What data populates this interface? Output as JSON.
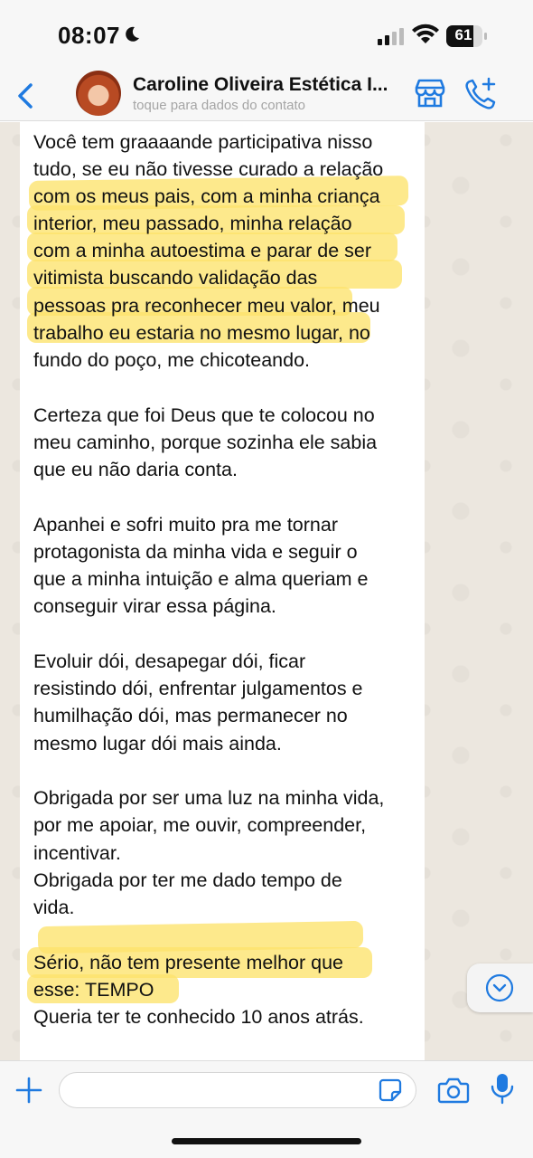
{
  "status_bar": {
    "time": "08:07",
    "battery": "61"
  },
  "header": {
    "contact_name": "Caroline Oliveira Estética I...",
    "contact_subtitle": "toque para dados do contato"
  },
  "message": {
    "lines": [
      "Você tem graaaande participativa nisso",
      "tudo, se eu não tivesse curado a relação",
      "com os meus pais, com a minha criança",
      "interior, meu passado, minha relação",
      "com a minha autoestima e parar de ser",
      "vitimista buscando validação das",
      "pessoas pra reconhecer meu valor, meu",
      "trabalho eu estaria no mesmo lugar, no",
      "fundo do poço, me chicoteando.",
      "",
      "Certeza que foi Deus que te colocou no",
      "meu caminho, porque sozinha ele sabia",
      "que eu não daria conta.",
      "",
      "Apanhei e sofri muito pra me tornar",
      "protagonista da minha vida e seguir o",
      "que a minha intuição e alma queriam e",
      "conseguir virar essa página.",
      "",
      "Evoluir dói, desapegar dói, ficar",
      "resistindo dói, enfrentar julgamentos e",
      "humilhação dói, mas permanecer no",
      "mesmo lugar dói mais ainda.",
      "",
      "Obrigada por ser uma luz na minha vida,",
      "por me apoiar, me ouvir, compreender,",
      "incentivar.",
      "Obrigada por ter me dado tempo de",
      "vida.",
      "",
      "Sério, não tem presente melhor que",
      "esse: TEMPO",
      "Queria ter te conhecido 10 anos atrás."
    ]
  },
  "input": {
    "placeholder": "",
    "value": ""
  },
  "colors": {
    "accent": "#1f7ae0",
    "highlight": "#fde36c",
    "chat_bg": "#ece7df"
  }
}
